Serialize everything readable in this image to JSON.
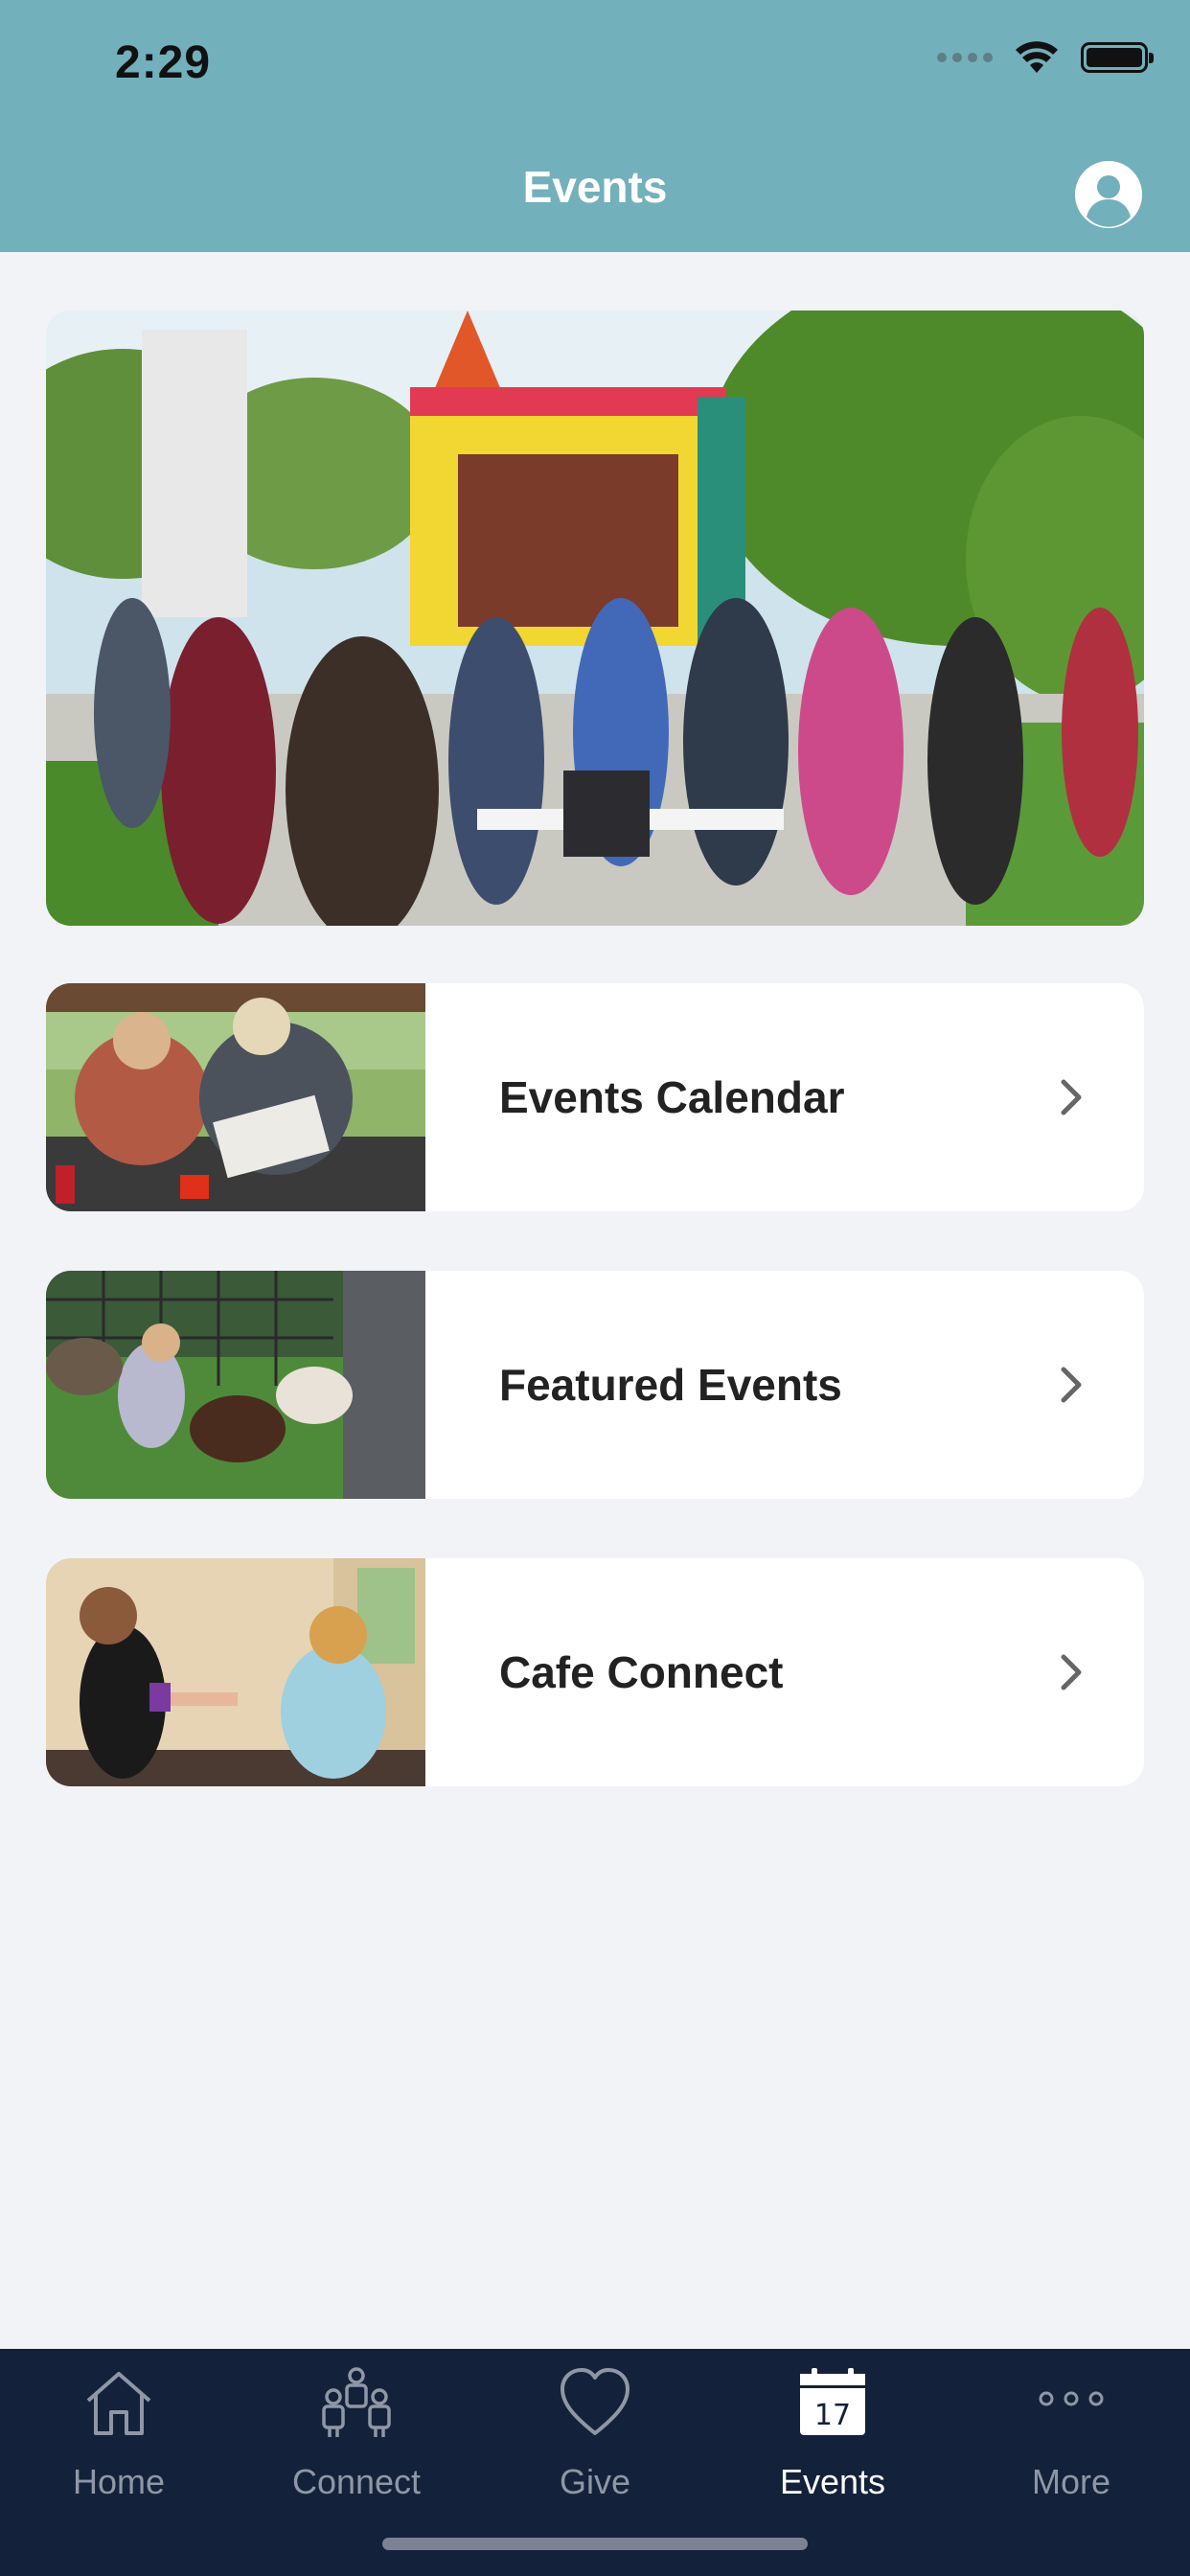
{
  "status_bar": {
    "time": "2:29"
  },
  "header": {
    "title": "Events",
    "background_color": "#72b0bc",
    "profile_icon": "user-profile-icon"
  },
  "hero": {
    "image": "outdoor-church-festival-photo"
  },
  "cards": [
    {
      "label": "Events Calendar",
      "image": "picnic-table-photo",
      "icon": "chevron-right-icon"
    },
    {
      "label": "Featured Events",
      "image": "petting-zoo-photo",
      "icon": "chevron-right-icon"
    },
    {
      "label": "Cafe Connect",
      "image": "cafe-counter-photo",
      "icon": "chevron-right-icon"
    }
  ],
  "tabbar": {
    "background_color": "#14213a",
    "tabs": [
      {
        "label": "Home",
        "icon": "house-icon",
        "active": false
      },
      {
        "label": "Connect",
        "icon": "people-group-icon",
        "active": false
      },
      {
        "label": "Give",
        "icon": "heart-icon",
        "active": false
      },
      {
        "label": "Events",
        "icon": "calendar-icon",
        "calendar_day": "17",
        "active": true
      },
      {
        "label": "More",
        "icon": "more-dots-icon",
        "active": false
      }
    ]
  }
}
